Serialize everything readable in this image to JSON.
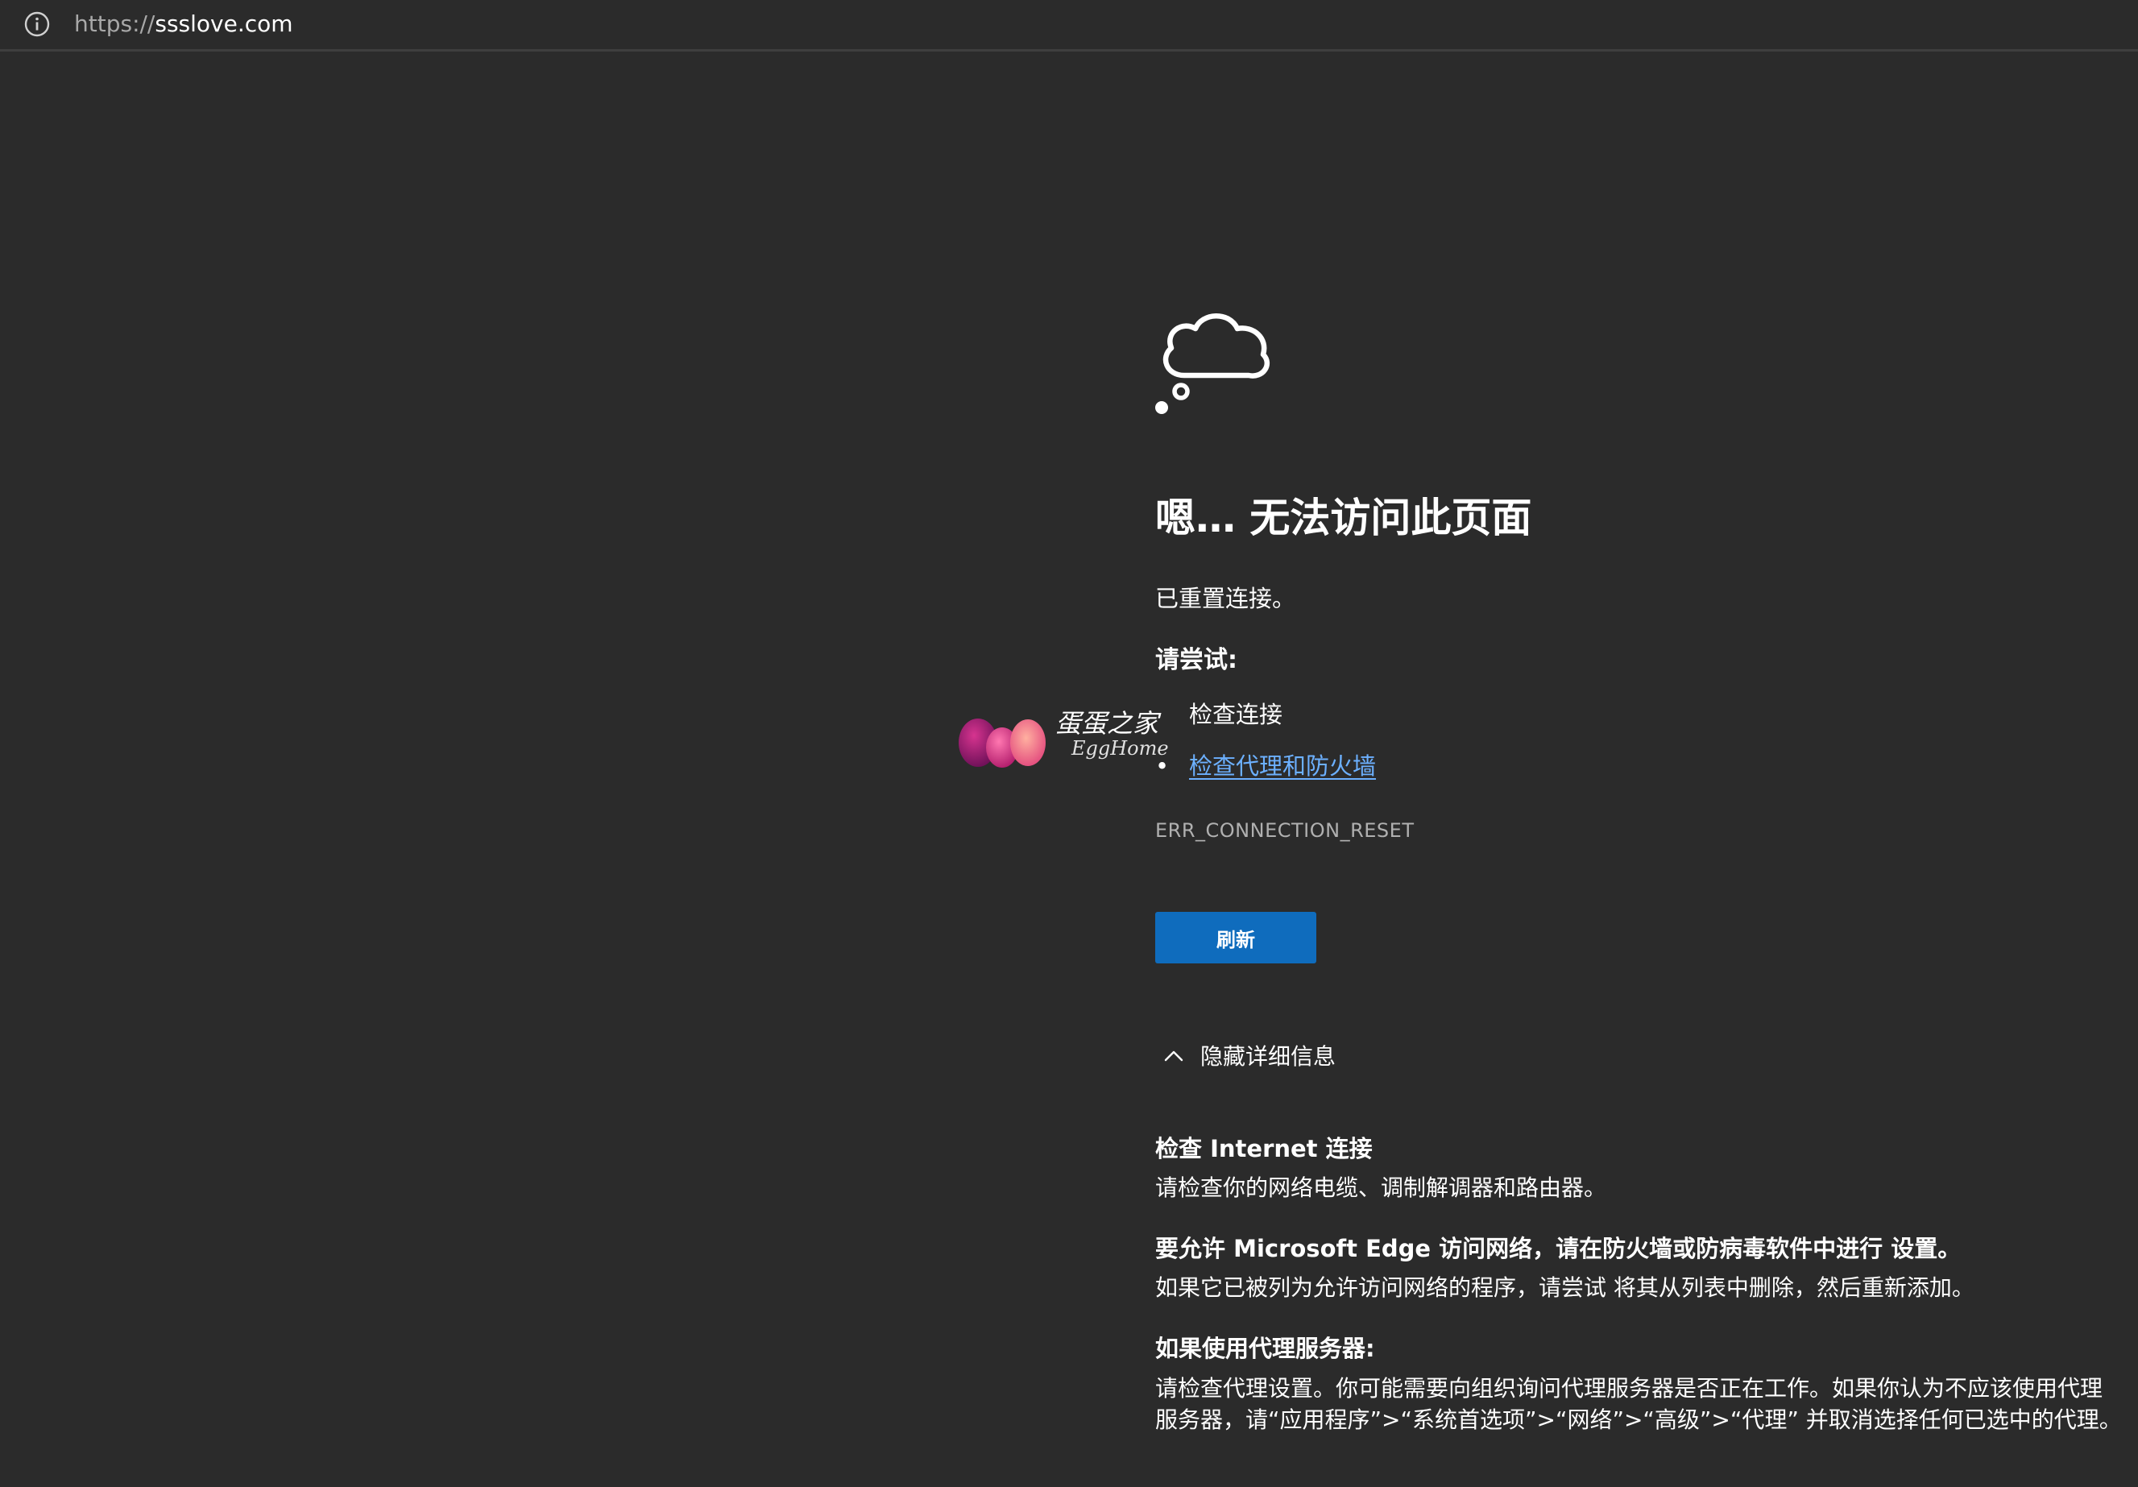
{
  "address_bar": {
    "info_icon": "info-circle-icon",
    "url_scheme": "https://",
    "url_host": "ssslove.com"
  },
  "error": {
    "icon": "thought-cloud-icon",
    "title": "嗯… 无法访问此页面",
    "subtitle": "已重置连接。",
    "try_heading": "请尝试:",
    "suggestions": [
      "检查连接",
      "检查代理和防火墙"
    ],
    "bullet": "•",
    "error_code": "ERR_CONNECTION_RESET",
    "refresh_label": "刷新",
    "details_toggle_label": "隐藏详细信息",
    "toggle_icon": "chevron-up-icon"
  },
  "details": [
    {
      "heading": "检查 Internet 连接",
      "text": "请检查你的网络电缆、调制解调器和路由器。"
    },
    {
      "heading": "要允许 Microsoft Edge 访问网络，请在防火墙或防病毒软件中进行 设置。",
      "text": "如果它已被列为允许访问网络的程序，请尝试 将其从列表中删除，然后重新添加。"
    },
    {
      "heading": "如果使用代理服务器:",
      "text": "请检查代理设置。你可能需要向组织询问代理服务器是否正在工作。如果你认为不应该使用代理服务器，请“应用程序”>“系统首选项”>“网络”>“高级”>“代理” 并取消选择任何已选中的代理。"
    }
  ],
  "watermark": {
    "text_cn": "蛋蛋之家",
    "text_en": "EggHome"
  },
  "colors": {
    "background": "#2b2b2b",
    "link": "#6cb0ff",
    "button": "#0f6cbd",
    "muted": "#b0b0b0"
  }
}
